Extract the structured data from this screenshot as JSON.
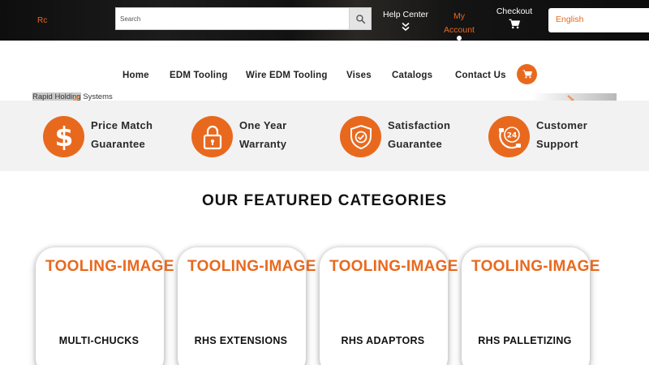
{
  "header": {
    "logo_text": "Rc",
    "search": {
      "placeholder": "Search",
      "value": ""
    },
    "help_center_label": "Help Center",
    "my_account_line1": "My",
    "my_account_line2": "Account",
    "checkout_label": "Checkout",
    "language": "English"
  },
  "nav": {
    "items": [
      {
        "label": "Home"
      },
      {
        "label": "EDM Tooling"
      },
      {
        "label": "Wire EDM Tooling"
      },
      {
        "label": "Vises"
      },
      {
        "label": "Catalogs"
      },
      {
        "label": "Contact Us"
      }
    ]
  },
  "slider": {
    "caption_highlight": "Rapid Holding",
    "caption_rest": " Systems"
  },
  "guarantees": [
    {
      "line1": "Price Match",
      "line2": "Guarantee",
      "icon": "dollar-icon"
    },
    {
      "line1": "One Year",
      "line2": "Warranty",
      "icon": "lock-icon"
    },
    {
      "line1": "Satisfaction",
      "line2": "Guarantee",
      "icon": "shield-check-icon"
    },
    {
      "line1": "Customer",
      "line2": "Support",
      "icon": "support-24-icon"
    }
  ],
  "featured": {
    "title": "OUR FEATURED CATEGORIES",
    "cards": [
      {
        "image_text": "TOOLING-IMAGE",
        "label": "MULTI-CHUCKS"
      },
      {
        "image_text": "TOOLING-IMAGE",
        "label": "RHS EXTENSIONS"
      },
      {
        "image_text": "TOOLING-IMAGE",
        "label": "RHS ADAPTORS"
      },
      {
        "image_text": "TOOLING-IMAGE",
        "label": "RHS PALLETIZING"
      }
    ]
  },
  "colors": {
    "accent": "#e8691e",
    "topbar": "#111111",
    "band": "#f2f2f2"
  }
}
